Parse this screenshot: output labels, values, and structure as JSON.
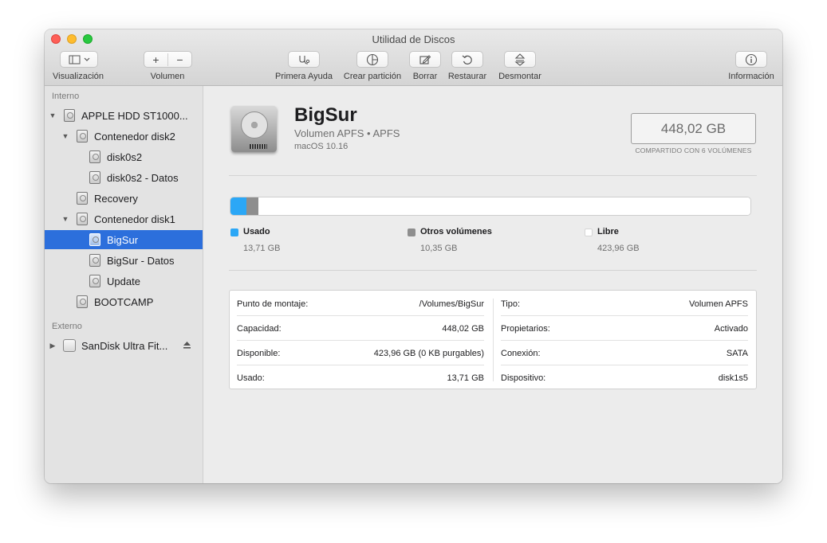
{
  "window": {
    "title": "Utilidad de Discos"
  },
  "toolbar": {
    "view_label": "Visualización",
    "volume_label": "Volumen",
    "firstaid_label": "Primera Ayuda",
    "partition_label": "Crear partición",
    "erase_label": "Borrar",
    "restore_label": "Restaurar",
    "unmount_label": "Desmontar",
    "info_label": "Información",
    "plus_glyph": "+",
    "minus_glyph": "−"
  },
  "sidebar": {
    "internal_header": "Interno",
    "external_header": "Externo",
    "items": [
      {
        "label": "APPLE HDD ST1000...",
        "icon": "hdd-icon"
      },
      {
        "label": "Contenedor disk2",
        "icon": "hdd-icon"
      },
      {
        "label": "disk0s2",
        "icon": "hdd-icon"
      },
      {
        "label": "disk0s2 - Datos",
        "icon": "hdd-icon"
      },
      {
        "label": "Recovery",
        "icon": "hdd-icon"
      },
      {
        "label": "Contenedor disk1",
        "icon": "hdd-icon"
      },
      {
        "label": "BigSur",
        "icon": "hdd-icon",
        "selected": true
      },
      {
        "label": "BigSur - Datos",
        "icon": "hdd-icon"
      },
      {
        "label": "Update",
        "icon": "hdd-icon"
      },
      {
        "label": "BOOTCAMP",
        "icon": "hdd-icon"
      }
    ],
    "external_items": [
      {
        "label": "SanDisk Ultra Fit...",
        "icon": "external-drive-icon"
      }
    ]
  },
  "volume": {
    "name": "BigSur",
    "subtitle": "Volumen APFS • APFS",
    "os": "macOS 10.16",
    "capacity": "448,02 GB",
    "shared_note": "COMPARTIDO CON 6 VOLÚMENES"
  },
  "usage": {
    "used": {
      "label": "Usado",
      "value": "13,71 GB",
      "color": "#2ba7f6",
      "fraction": 0.0306
    },
    "other": {
      "label": "Otros volúmenes",
      "value": "10,35 GB",
      "color": "#8e8e8e",
      "fraction": 0.0231
    },
    "free": {
      "label": "Libre",
      "value": "423,96 GB",
      "color": "#ffffff",
      "fraction": 0.9463
    }
  },
  "info": {
    "left": [
      {
        "key": "Punto de montaje:",
        "value": "/Volumes/BigSur"
      },
      {
        "key": "Capacidad:",
        "value": "448,02 GB"
      },
      {
        "key": "Disponible:",
        "value": "423,96 GB (0 KB purgables)"
      },
      {
        "key": "Usado:",
        "value": "13,71 GB"
      }
    ],
    "right": [
      {
        "key": "Tipo:",
        "value": "Volumen APFS"
      },
      {
        "key": "Propietarios:",
        "value": "Activado"
      },
      {
        "key": "Conexión:",
        "value": "SATA"
      },
      {
        "key": "Dispositivo:",
        "value": "disk1s5"
      }
    ]
  }
}
